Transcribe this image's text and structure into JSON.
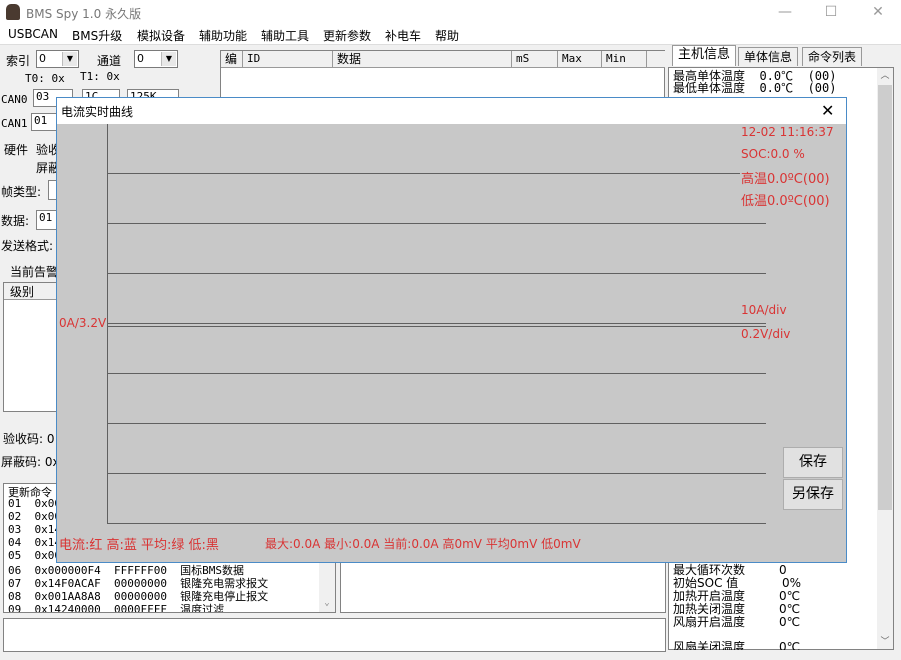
{
  "window": {
    "title": "BMS Spy 1.0 永久版",
    "minimize": "—",
    "maximize": "☐",
    "close": "✕"
  },
  "menu": [
    "USBCAN",
    "BMS升级",
    "模拟设备",
    "辅助功能",
    "辅助工具",
    "更新参数",
    "补电车",
    "帮助"
  ],
  "left": {
    "index_label": "索引",
    "index_value": "0",
    "channel_label": "通道",
    "channel_value": "0",
    "t0": "T0: 0x",
    "t1": "T1: 0x",
    "can0_label": "CAN0",
    "can0_value": "03",
    "can0_v2": "1C",
    "can0_v3": "125K",
    "can1_label": "CAN1",
    "can1_value": "01",
    "hardware_label": "硬件",
    "verify_label": "验收",
    "mask_label": "屏蔽",
    "frame_type_label": "帧类型:",
    "data_label": "数据:",
    "data_value": "01",
    "send_format_label": "发送格式:",
    "alarm_tab": "当前告警",
    "level_header": "级别",
    "verify_code": "验收码: 0",
    "mask_code": "屏蔽码: 0x"
  },
  "table": {
    "headers": [
      "编",
      "ID",
      "数据",
      "mS",
      "Max",
      "Min"
    ]
  },
  "tabs": [
    "主机信息",
    "单体信息",
    "命令列表"
  ],
  "info_top": [
    "最高单体温度  0.0℃  (00)",
    "最低单体温度  0.0℃  (00)"
  ],
  "info_bottom": [
    {
      "k": "最大循环次数",
      "v": "0"
    },
    {
      "k": "初始SOC 值",
      "v": "0%"
    },
    {
      "k": "加热开启温度",
      "v": "0℃"
    },
    {
      "k": "加热关闭温度",
      "v": "0℃"
    },
    {
      "k": "风扇开启温度",
      "v": "0℃"
    },
    {
      "k": "风扇关闭温度",
      "v": "0℃"
    }
  ],
  "cmd_list": [
    "更新命令",
    "01  0x00",
    "02  0x00",
    "03  0x14",
    "04  0x14",
    "05  0x00",
    "06  0x000000F4  FFFFFF00  国标BMS数据",
    "07  0x14F0ACAF  00000000  银隆充电需求报文",
    "08  0x001AA8A8  00000000  银隆充电停止报文",
    "09  0x14240000  0000FFFF  温度过滤"
  ],
  "dialog": {
    "title": "电流实时曲线",
    "close": "✕",
    "timestamp": "12-02 11:16:37",
    "soc": "SOC:0.0 %",
    "high_temp": "高温0.0ºC(00)",
    "low_temp": "低温0.0ºC(00)",
    "y_origin": "0A/3.2V",
    "current_scale": "10A/div",
    "voltage_scale": "0.2V/div",
    "legend": "电流:红 高:蓝 平均:绿 低:黑",
    "stats": "最大:0.0A 最小:0.0A 当前:0.0A 高0mV 平均0mV 低0mV",
    "save": "保存",
    "save_as": "另保存",
    "text_color": "#d93434",
    "plot_bg": "#c8c8c8"
  }
}
